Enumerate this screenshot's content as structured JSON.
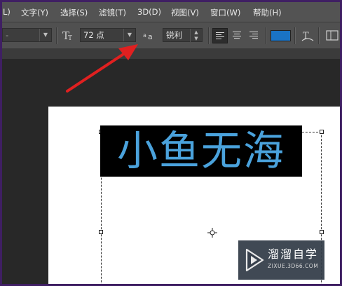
{
  "menu": {
    "items": [
      {
        "label": "L)"
      },
      {
        "label": "文字(Y)"
      },
      {
        "label": "选择(S)"
      },
      {
        "label": "滤镜(T)"
      },
      {
        "label": "3D(D)"
      },
      {
        "label": "视图(V)"
      },
      {
        "label": "窗口(W)"
      },
      {
        "label": "帮助(H)"
      }
    ]
  },
  "options": {
    "font_style_value": "-",
    "font_size_value": "72 点",
    "antialias_value": "锐利",
    "text_color": "#1a73c5"
  },
  "canvas": {
    "text": "小鱼无海",
    "text_color": "#4aa2dc"
  },
  "watermark": {
    "title": "溜溜自学",
    "url": "ZIXUE.3D66.COM"
  },
  "annotation": {
    "arrow_color": "#e02020"
  }
}
